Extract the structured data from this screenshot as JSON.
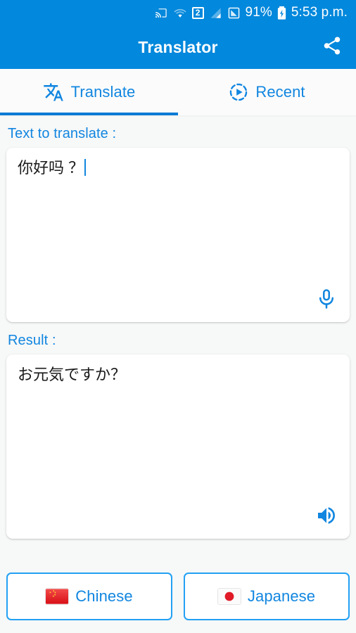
{
  "status_bar": {
    "sim_badge": "2",
    "battery_percent": "91%",
    "time": "5:53 p.m.",
    "icons": [
      "cast-icon",
      "wifi-icon",
      "sim2-badge",
      "signal-bars-icon",
      "signal-secondary-icon",
      "battery-charging-icon"
    ]
  },
  "app_bar": {
    "title": "Translator",
    "share_icon": "share-icon"
  },
  "tabs": [
    {
      "label": "Translate",
      "icon": "translate-icon",
      "active": true
    },
    {
      "label": "Recent",
      "icon": "history-play-icon",
      "active": false
    }
  ],
  "input_section": {
    "label": "Text to translate :",
    "value": "你好吗 ？",
    "mic_icon": "microphone-icon"
  },
  "result_section": {
    "label": "Result :",
    "value": "お元気ですか？",
    "speaker_icon": "speaker-icon"
  },
  "language_buttons": [
    {
      "name": "Chinese",
      "flag": "flag-china",
      "role": "source"
    },
    {
      "name": "Japanese",
      "flag": "flag-japan",
      "role": "target"
    }
  ],
  "colors": {
    "primary": "#0288dc",
    "accent": "#1186e0",
    "tab_indicator": "#0c7cd5",
    "button_border": "#22a1f4",
    "background": "#f7f8f8",
    "card": "#ffffff",
    "text": "#1a1a1a"
  }
}
